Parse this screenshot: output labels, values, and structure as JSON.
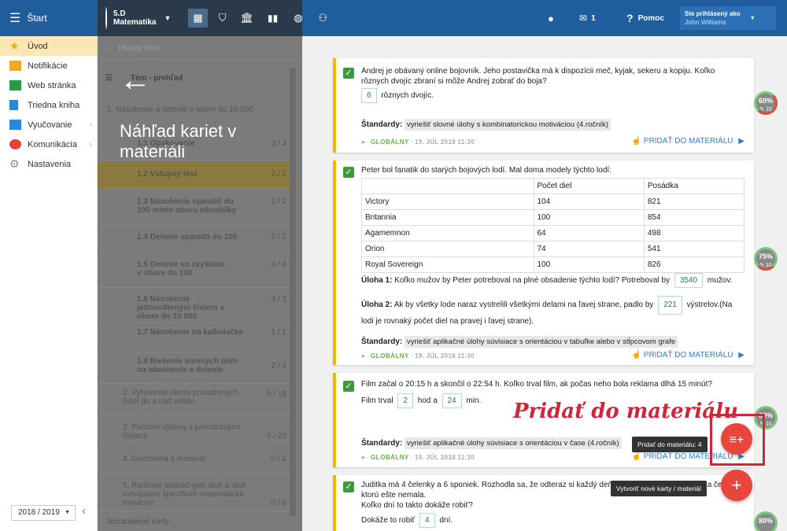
{
  "topbar": {
    "start_label": "Štart",
    "class_name": "5.D",
    "class_subject": "Matematika",
    "notif_count": "1",
    "help_label": "Pomoc",
    "logged_in_label": "Ste prihlásený ako",
    "user_name": "John Williams"
  },
  "sidebar": {
    "items": [
      {
        "label": "Úvod",
        "icon": "star-icon"
      },
      {
        "label": "Notifikácie",
        "icon": "envelope-icon"
      },
      {
        "label": "Web stránka",
        "icon": "home-icon"
      },
      {
        "label": "Triedna kniha",
        "icon": "book-icon"
      },
      {
        "label": "Vyučovanie",
        "icon": "teaching-icon"
      },
      {
        "label": "Komunikácia",
        "icon": "chat-icon"
      },
      {
        "label": "Nastavenia",
        "icon": "gear-icon"
      }
    ],
    "year": "2018 / 2019"
  },
  "center": {
    "search_placeholder": "Hľadaj témy",
    "heading": "Tém - prehľad",
    "overlay_title": "Náhľad kariet v materiáli",
    "chapters": [
      {
        "label": "1. Násobenie a delenie v obore do 10 000",
        "count": ""
      },
      {
        "label": "1.1 Opakovanie",
        "count": "3 / 3"
      },
      {
        "label": "1.2 Vstupný test",
        "count": "2 / 2"
      },
      {
        "label": "1.3 Násobenie spamäti do 100 mimo oboru násobilky",
        "count": "2 / 2"
      },
      {
        "label": "1.4 Delenie spamäti do 100",
        "count": "2 / 2"
      },
      {
        "label": "1.5 Delenie so zvyškom v obore do 100",
        "count": "4 / 4"
      },
      {
        "label": "1.6 Násobenie jednociferným číslom v obore do 10 000",
        "count": "3 / 3"
      },
      {
        "label": "1.7 Násobenie na kalkulačke",
        "count": "1 / 1"
      },
      {
        "label": "1.8 Riešenie slovných úloh na násobenie a delenie",
        "count": "2 / 3"
      },
      {
        "label": "2. Vytvorenie oboru prirodzených čísel do a nad milión",
        "count": "0 / 18"
      },
      {
        "label": "3. Počtové výkony s prirodzenými číslami",
        "count": "0 / 23"
      },
      {
        "label": "4. Geometria a meranie",
        "count": "0 / 2"
      },
      {
        "label": "5. Riešenie aplikačných úloh a úloh rozvíjajúce špecifické matematické myslenie",
        "count": "0 / 6"
      },
      {
        "label": "Nezaradené karty",
        "count": ""
      }
    ]
  },
  "cards": [
    {
      "question": "Andrej je obávaný online bojovník. Jeho postavička má k dispozícii meč, kyjak, sekeru a kopiju. Koľko rôznych dvojíc zbraní si môže Andrej zobrať do boja?",
      "answer": "6",
      "answer_suffix": "rôznych dvojíc.",
      "standard_label": "Štandardy:",
      "standard": "vyriešiť slovné úlohy s kombinatorickou motiváciou (4.ročník)",
      "scope": "GLOBÁLNY",
      "date": "19. JÚL 2018 11:30",
      "add_label": "PRIDAŤ DO MATERIÁLU",
      "pct": "60%",
      "pct_sub": "10"
    },
    {
      "question": "Peter bol fanatik do starých bojových lodí. Mal doma modely týchto lodí:",
      "table_header": [
        "",
        "Počet diel",
        "Posádka"
      ],
      "table_rows": [
        [
          "Victory",
          "104",
          "821"
        ],
        [
          "Britannia",
          "100",
          "854"
        ],
        [
          "Agamemnon",
          "64",
          "498"
        ],
        [
          "Orion",
          "74",
          "541"
        ],
        [
          "Royal Sovereign",
          "100",
          "826"
        ]
      ],
      "task1_label": "Úloha 1:",
      "task1_text": "Koľko mužov by Peter potreboval na plné obsadenie týchto lodí? Potreboval by",
      "task1_answer": "3540",
      "task1_suffix": "mužov.",
      "task2_label": "Úloha 2:",
      "task2_text": "Ak by všetky lode naraz vystrelili všetkými delami na ľavej strane, padlo by",
      "task2_answer": "221",
      "task2_suffix": "výstrelov.(Na lodi je rovnaký počet diel na pravej i ľavej strane).",
      "standard_label": "Štandardy:",
      "standard": "vyriešiť aplikačné úlohy súvisiace s orientáciou v tabuľke alebo v stĺpcovom grafe",
      "scope": "GLOBÁLNY",
      "date": "19. JÚL 2018 11:30",
      "add_label": "PRIDAŤ DO MATERIÁLU",
      "pct": "75%",
      "pct_sub": "10"
    },
    {
      "question": "Film začal o 20:15 h a skončil o 22:54 h. Koľko trval film, ak počas neho bola reklama dlhá 15 minút?",
      "prefix": "Film trval",
      "a1": "2",
      "mid": "hod a",
      "a2": "24",
      "suffix": "min.",
      "standard_label": "Štandardy:",
      "standard": "vyriešiť aplikačné úlohy súvisiace s orientáciou v čase (4.ročník)",
      "scope": "GLOBÁLNY",
      "date": "19. JÚL 2018 11:30",
      "add_label": "PRIDAŤ DO MATERIÁLU",
      "pct": "80%",
      "pct_sub": "10"
    },
    {
      "question": "Juditka má 4 čelenky a 6 sponiek. Rozhodla sa, že odteraz si každý deň dá inú kombináciu sponky a čelenky, ktorú ešte nemala.",
      "q2": "Koľko dní to takto dokáže robiť?",
      "prefix": "Dokáže to robiť",
      "answer": "4",
      "suffix": "dní.",
      "pct": "80%"
    }
  ],
  "annotation": "Pridať do materiálu",
  "tooltip_add": "Pridať do materiálu: 4",
  "tooltip_new": "Vytvoriť nové karty / materiál"
}
